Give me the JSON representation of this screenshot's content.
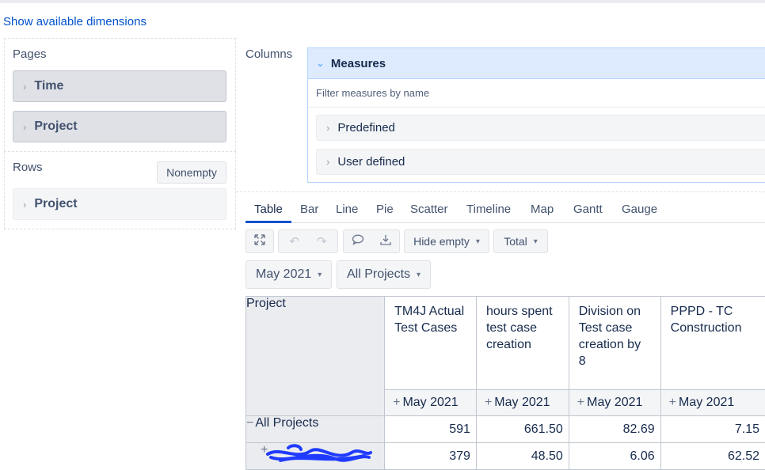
{
  "show_dims_link": "Show available dimensions",
  "pages": {
    "title": "Pages",
    "items": [
      "Time",
      "Project"
    ]
  },
  "rows": {
    "title": "Rows",
    "nonempty_label": "Nonempty",
    "items": [
      "Project"
    ]
  },
  "columns": {
    "title": "Columns",
    "measures_label": "Measures",
    "filter_placeholder": "Filter measures by name",
    "groups": [
      "Predefined",
      "User defined"
    ]
  },
  "tabs": [
    "Table",
    "Bar",
    "Line",
    "Pie",
    "Scatter",
    "Timeline",
    "Map",
    "Gantt",
    "Gauge"
  ],
  "active_tab": "Table",
  "toolbar": {
    "hide_empty_label": "Hide empty",
    "total_label": "Total"
  },
  "filters": {
    "time": "May 2021",
    "project": "All Projects"
  },
  "table": {
    "row_header": "Project",
    "columns": [
      {
        "header": "TM4J Actual Test Cases",
        "period": "May 2021"
      },
      {
        "header": "hours spent test case creation",
        "period": "May 2021"
      },
      {
        "header": "Division on Test case creation by 8",
        "period": "May 2021"
      },
      {
        "header": "PPPD - TC Construction",
        "period": "May 2021"
      }
    ],
    "rows": [
      {
        "label": "All Projects",
        "values": [
          "591",
          "661.50",
          "82.69",
          "7.15"
        ]
      },
      {
        "label": "",
        "values": [
          "379",
          "48.50",
          "6.06",
          "62.52"
        ]
      }
    ]
  },
  "colors": {
    "link": "#0052cc",
    "measures_bg": "#deebff",
    "redaction": "#1f3bff"
  }
}
